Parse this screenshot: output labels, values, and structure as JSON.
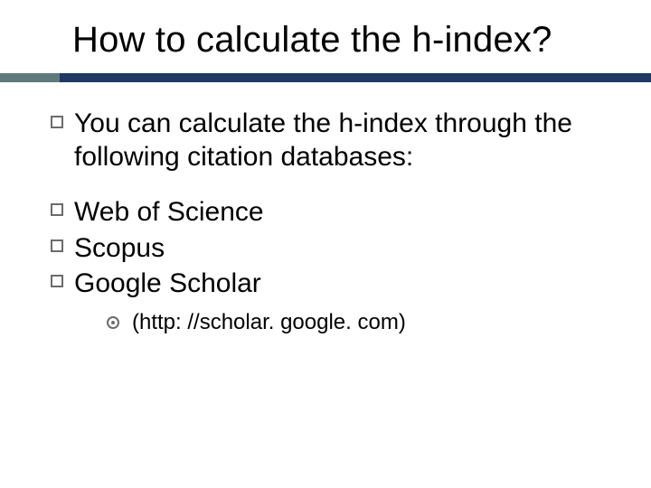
{
  "title": "How to calculate the h-index?",
  "intro": "You can calculate the h-index through the following citation databases:",
  "databases": {
    "0": "Web of Science",
    "1": "Scopus",
    "2": "Google Scholar"
  },
  "sub": "(http: //scholar. google. com)"
}
